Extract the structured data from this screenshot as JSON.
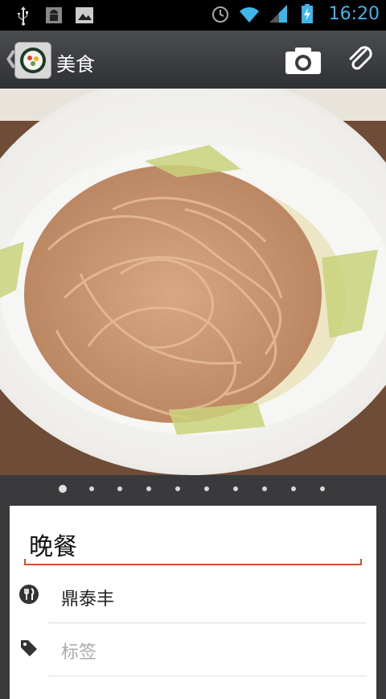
{
  "status_bar": {
    "time": "16:20",
    "icons": [
      "usb-icon",
      "android-debug-icon",
      "gallery-icon",
      "alarm-icon",
      "wifi-icon",
      "signal-icon",
      "battery-charging-icon"
    ],
    "accent_color": "#3fb6ea"
  },
  "action_bar": {
    "title": "美食",
    "back_icon": "chevron-left-icon",
    "app_icon": "sushi-roll-icon",
    "actions": [
      "camera-icon",
      "paperclip-icon"
    ]
  },
  "photo": {
    "pager_count": 10,
    "pager_active_index": 0
  },
  "entry": {
    "title_value": "晚餐",
    "accent_color": "#d0512c",
    "place": {
      "icon": "fork-knife-icon",
      "value": "鼎泰丰"
    },
    "tags": {
      "icon": "tag-icon",
      "placeholder": "标签"
    }
  }
}
